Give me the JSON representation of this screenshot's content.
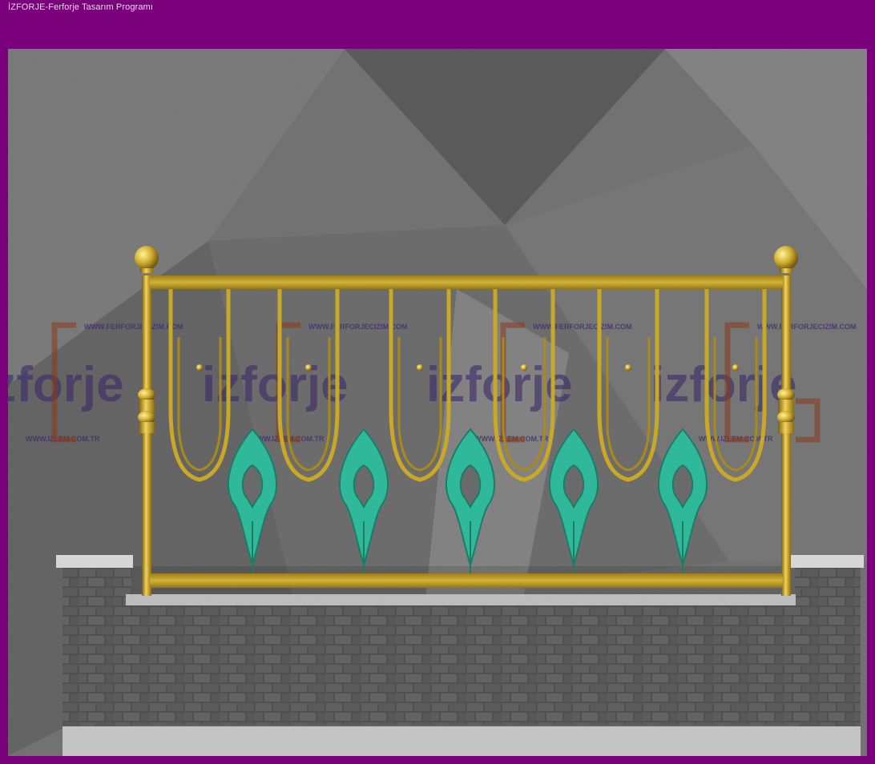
{
  "window": {
    "title": "İZFORJE-Ferforje Tasarım Programı"
  },
  "watermark": {
    "url_top": "WWW.FERFORJECIZIM.COM",
    "url_bottom": "WWW.IZLEM.COM.TR",
    "logo_text": "izforje"
  },
  "colors": {
    "window_bg": "#7b007b",
    "gold": "#c9a825",
    "green": "#2fb89a",
    "wall": "#5a5a5a",
    "coping": "#c8c8c8",
    "watermark": "#3a2a6a"
  },
  "icons": {
    "finial": "brass-ball-finial",
    "spear": "green-spear-ornament"
  }
}
